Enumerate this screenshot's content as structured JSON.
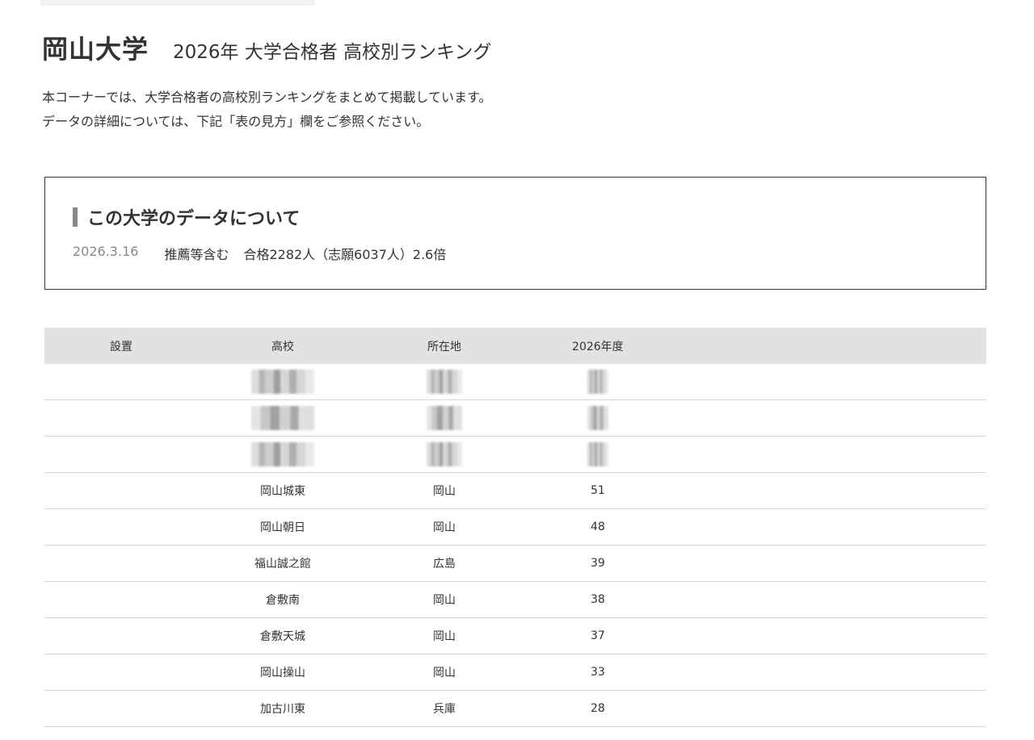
{
  "header": {
    "university": "岡山大学",
    "subtitle": "2026年 大学合格者 高校別ランキング"
  },
  "intro": {
    "line1": "本コーナーでは、大学合格者の高校別ランキングをまとめて掲載しています。",
    "line2": "データの詳細については、下記「表の見方」欄をご参照ください。"
  },
  "info_box": {
    "heading": "この大学のデータについて",
    "date": "2026.3.16",
    "basis": "推薦等含む",
    "stats": "合格2282人（志願6037人）2.6倍"
  },
  "table": {
    "headers": {
      "setchi": "設置",
      "school": "高校",
      "location": "所在地",
      "year": "2026年度"
    },
    "rows": [
      {
        "setchi": "",
        "school": "",
        "location": "",
        "count": ""
      },
      {
        "setchi": "",
        "school": "",
        "location": "",
        "count": ""
      },
      {
        "setchi": "",
        "school": "",
        "location": "",
        "count": ""
      },
      {
        "setchi": "",
        "school": "岡山城東",
        "location": "岡山",
        "count": "51"
      },
      {
        "setchi": "",
        "school": "岡山朝日",
        "location": "岡山",
        "count": "48"
      },
      {
        "setchi": "",
        "school": "福山誠之館",
        "location": "広島",
        "count": "39"
      },
      {
        "setchi": "",
        "school": "倉敷南",
        "location": "岡山",
        "count": "38"
      },
      {
        "setchi": "",
        "school": "倉敷天城",
        "location": "岡山",
        "count": "37"
      },
      {
        "setchi": "",
        "school": "岡山操山",
        "location": "岡山",
        "count": "33"
      },
      {
        "setchi": "",
        "school": "加古川東",
        "location": "兵庫",
        "count": "28"
      }
    ]
  },
  "colors": {
    "header_bg": "#e2e2e2",
    "row_border": "#d6d6d6",
    "box_border": "#333333",
    "heading_bar": "#888888",
    "date_text": "#888888"
  }
}
